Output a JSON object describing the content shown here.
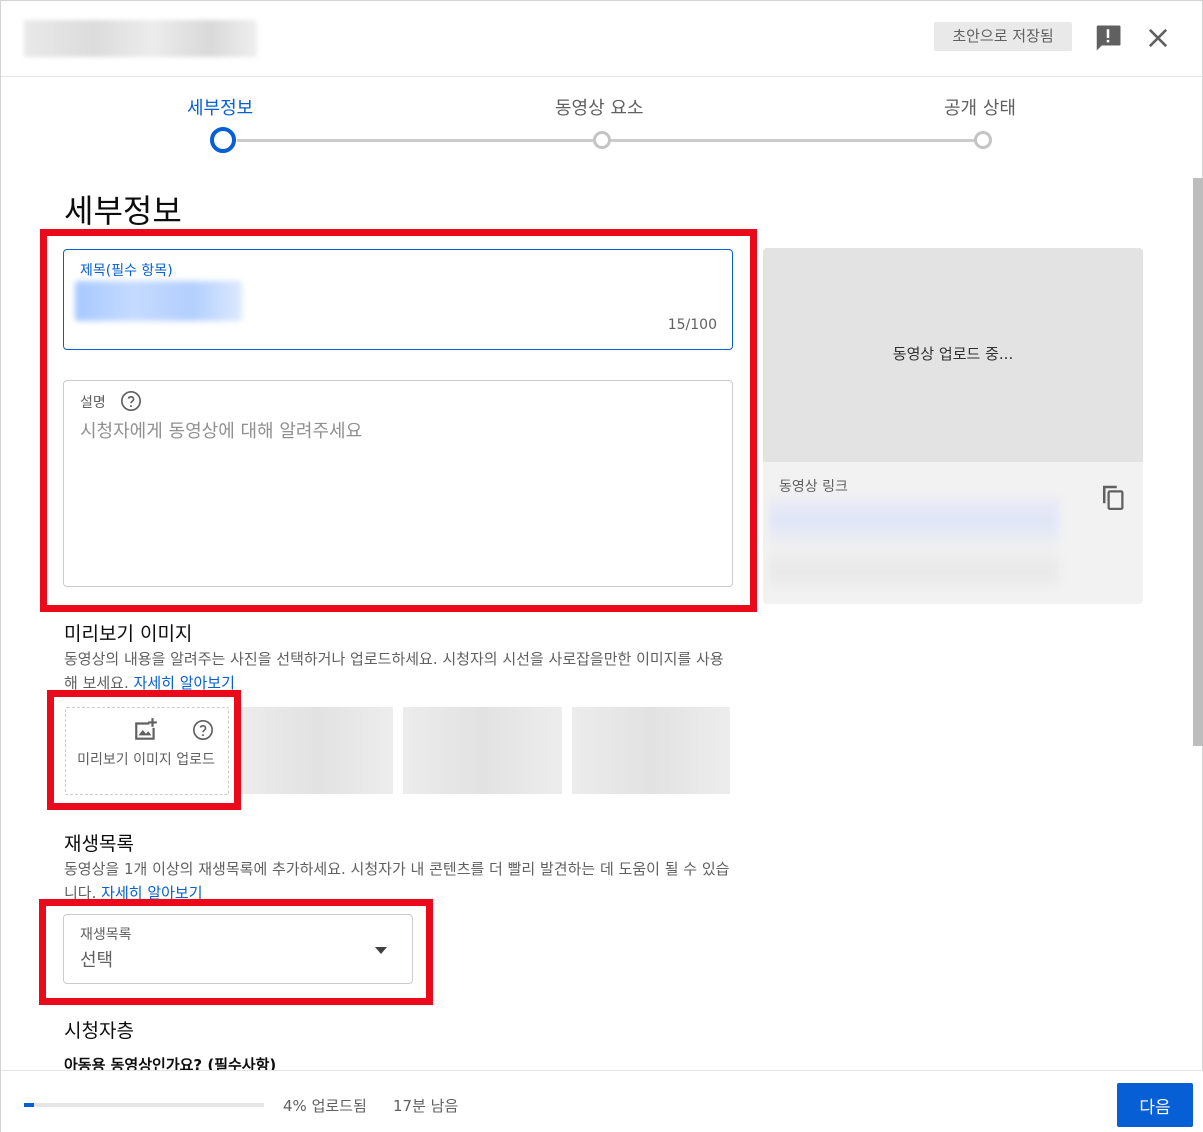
{
  "header": {
    "draft_status": "초안으로 저장됨",
    "feedback_icon": "feedback-icon",
    "close_icon": "close-icon"
  },
  "stepper": {
    "steps": [
      {
        "label": "세부정보",
        "active": true
      },
      {
        "label": "동영상 요소",
        "active": false
      },
      {
        "label": "공개 상태",
        "active": false
      }
    ]
  },
  "main": {
    "page_title": "세부정보",
    "title_field": {
      "label": "제목(필수 항목)",
      "char_count": "15/100"
    },
    "description_field": {
      "label": "설명",
      "placeholder": "시청자에게 동영상에 대해 알려주세요"
    },
    "thumbnail": {
      "title": "미리보기 이미지",
      "description": "동영상의 내용을 알려주는 사진을 선택하거나 업로드하세요. 시청자의 시선을 사로잡을만한 이미지를 사용해 보세요.",
      "learn_more": "자세히 알아보기",
      "upload_label": "미리보기 이미지 업로드"
    },
    "playlist": {
      "title": "재생목록",
      "description": "동영상을 1개 이상의 재생목록에 추가하세요. 시청자가 내 콘텐츠를 더 빨리 발견하는 데 도움이 될 수 있습니다.",
      "learn_more": "자세히 알아보기",
      "select_label": "재생목록",
      "select_value": "선택"
    },
    "audience": {
      "title": "시청자층",
      "question": "아동용 동영상인가요? (필수사항)"
    }
  },
  "video_panel": {
    "status": "동영상 업로드 중...",
    "link_label": "동영상 링크",
    "copy_icon": "copy-icon"
  },
  "footer": {
    "progress_percent": 4,
    "progress_text": "4% 업로드됨",
    "time_remaining": "17분 남음",
    "next_label": "다음"
  },
  "colors": {
    "accent": "#065fd4",
    "highlight": "#ea0a1c"
  }
}
